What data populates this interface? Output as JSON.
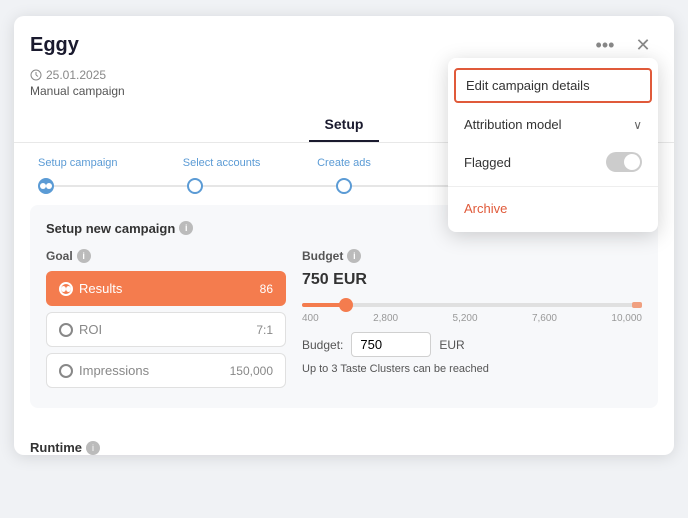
{
  "app": {
    "title": "Eggy",
    "date": "25.01.2025",
    "type": "Manual campaign"
  },
  "titlebar": {
    "more_label": "•••",
    "close_label": "✕"
  },
  "tabs": [
    {
      "id": "setup",
      "label": "Setup",
      "active": true
    }
  ],
  "steps": [
    {
      "id": "setup-campaign",
      "label": "Setup campaign",
      "active": true
    },
    {
      "id": "select-accounts",
      "label": "Select accounts",
      "active": false
    },
    {
      "id": "create-ads",
      "label": "Create ads",
      "active": false
    },
    {
      "id": "step4",
      "label": "",
      "active": false
    },
    {
      "id": "step5",
      "label": "",
      "active": false
    }
  ],
  "section": {
    "title": "Setup new campaign",
    "goal_title": "Goal",
    "budget_title": "Budget"
  },
  "goals": [
    {
      "id": "results",
      "label": "Results",
      "value": "86",
      "selected": true
    },
    {
      "id": "roi",
      "label": "ROI",
      "value": "7:1",
      "selected": false
    },
    {
      "id": "impressions",
      "label": "Impressions",
      "value": "150,000",
      "selected": false
    }
  ],
  "budget": {
    "amount": "750 EUR",
    "slider_value": "750",
    "currency": "EUR",
    "label": "Budget:",
    "min": "400",
    "marks": [
      "400",
      "2,800",
      "5,200",
      "7,600",
      "10,000"
    ],
    "note": "Up to 3 Taste Clusters can be reached"
  },
  "runtime": {
    "title": "Runtime"
  },
  "dropdown": {
    "edit_label": "Edit campaign details",
    "attribution_label": "Attribution model",
    "flagged_label": "Flagged",
    "archive_label": "Archive"
  }
}
